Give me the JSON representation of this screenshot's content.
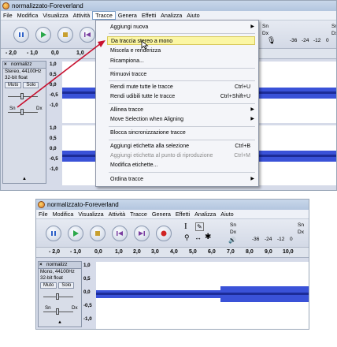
{
  "window1": {
    "title": "normalizzato-Foreverland",
    "menus": [
      "File",
      "Modifica",
      "Visualizza",
      "Attività",
      "Tracce",
      "Genera",
      "Effetti",
      "Analizza",
      "Aiuto"
    ],
    "meter": {
      "top_left": "Sn",
      "bottom_left": "Dx",
      "labels": [
        "-36",
        "-24",
        "-12",
        "0"
      ],
      "right_top": "Sn",
      "right_bottom": "Dx"
    },
    "ruler": [
      "- 2,0",
      "- 1,0",
      "0,0",
      "1,0"
    ],
    "track": {
      "name": "normalizz",
      "info1": "Stereo, 44100Hz",
      "info2": "32-bit float",
      "mute": "Muto",
      "solo": "Solo",
      "pan_left": "Sn",
      "pan_right": "Dx",
      "scale_top": [
        "1,0",
        "0,5",
        "0,0",
        "-0,5",
        "-1,0"
      ],
      "scale_bottom": [
        "1,0",
        "0,5",
        "0,0",
        "-0,5",
        "-1,0"
      ]
    },
    "dropdown": {
      "items": [
        {
          "label": "Aggiungi nuova",
          "submenu": true
        },
        {
          "label": "Da traccia stereo a mono",
          "highlighted": true
        },
        {
          "label": "Miscela e renderizza"
        },
        {
          "label": "Ricampiona..."
        },
        {
          "label": "Rimuovi tracce"
        },
        {
          "label": "Rendi mute tutte le tracce",
          "shortcut": "Ctrl+U"
        },
        {
          "label": "Rendi udibili tutte le tracce",
          "shortcut": "Ctrl+Shift+U"
        },
        {
          "label": "Allinea tracce",
          "submenu": true
        },
        {
          "label": "Move Selection when Aligning",
          "submenu": true
        },
        {
          "label": "Blocca sincronizzazione tracce"
        },
        {
          "label": "Aggiungi etichetta alla selezione",
          "shortcut": "Ctrl+B"
        },
        {
          "label": "Aggiungi etichetta al punto di riproduzione",
          "shortcut": "Ctrl+M",
          "disabled": true
        },
        {
          "label": "Modifica etichette..."
        },
        {
          "label": "Ordina tracce",
          "submenu": true
        }
      ]
    }
  },
  "window2": {
    "title": "normalizzato-Foreverland",
    "menus": [
      "File",
      "Modifica",
      "Visualizza",
      "Attività",
      "Tracce",
      "Genera",
      "Effetti",
      "Analizza",
      "Aiuto"
    ],
    "meter": {
      "top_left": "Sn",
      "bottom_left": "Dx",
      "labels": [
        "-36",
        "-24",
        "-12",
        "0"
      ],
      "right_top": "Sn",
      "right_bottom": "Dx"
    },
    "ruler": [
      "- 2,0",
      "- 1,0",
      "0,0",
      "1,0",
      "2,0",
      "3,0",
      "4,0",
      "5,0",
      "6,0",
      "7,0",
      "8,0",
      "9,0",
      "10,0"
    ],
    "track": {
      "name": "normalizz",
      "info1": "Mono, 44100Hz",
      "info2": "32-bit float",
      "mute": "Muto",
      "solo": "Solo",
      "pan_left": "Sn",
      "pan_right": "Dx",
      "scale": [
        "1,0",
        "0,5",
        "0,0",
        "-0,5",
        "-1,0"
      ]
    }
  },
  "colors": {
    "waveform": "#3a52d8",
    "highlight": "#fbf6a4",
    "arrow": "#c8102e",
    "play": "#2aa84a",
    "record": "#d02424",
    "pause": "#2f62c8"
  }
}
